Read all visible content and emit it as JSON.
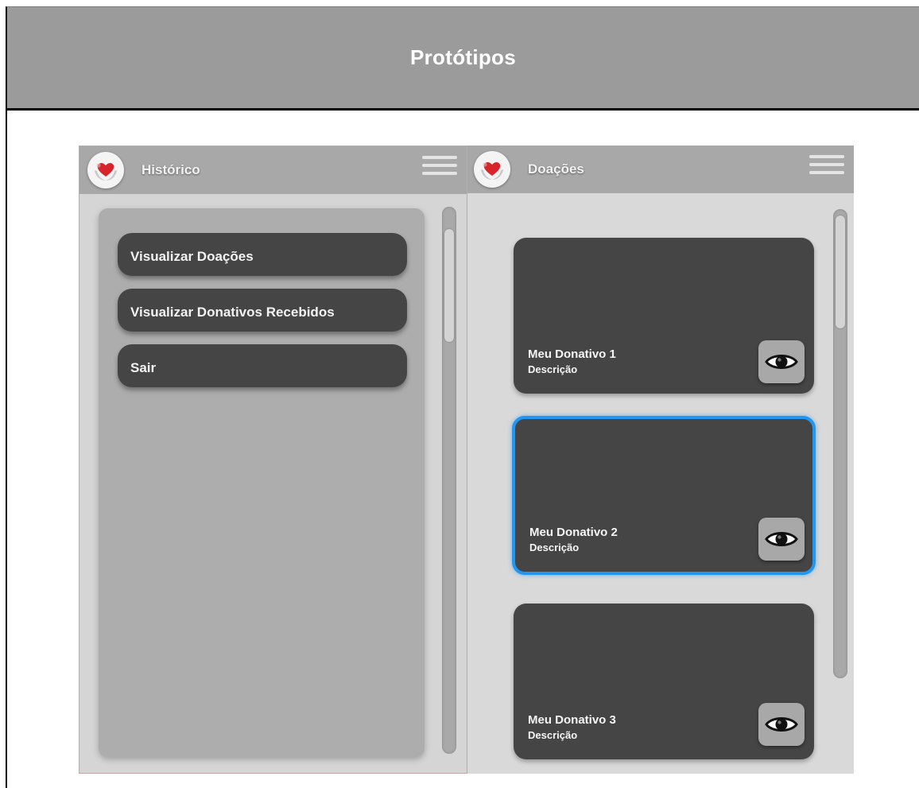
{
  "document": {
    "title": "Protótipos"
  },
  "screens": [
    {
      "app_title": "Histórico",
      "menu_items": [
        {
          "label": "Visualizar Doações"
        },
        {
          "label": "Visualizar Donativos Recebidos"
        },
        {
          "label": "Sair"
        }
      ]
    },
    {
      "app_title": "Doações",
      "cards": [
        {
          "title": "Meu Donativo 1",
          "description": "Descrição",
          "selected": false
        },
        {
          "title": "Meu Donativo 2",
          "description": "Descrição",
          "selected": true
        },
        {
          "title": "Meu Donativo 3",
          "description": "Descrição",
          "selected": false
        }
      ]
    }
  ],
  "icons": {
    "logo": "heart-hands-icon",
    "menu": "hamburger-menu-icon",
    "view": "eye-icon"
  },
  "colors": {
    "header_bg": "#9b9b9b",
    "appbar_bg": "#a8a8a8",
    "card_bg": "#454545",
    "selection_accent": "#2196f3",
    "heart": "#d7262b"
  }
}
